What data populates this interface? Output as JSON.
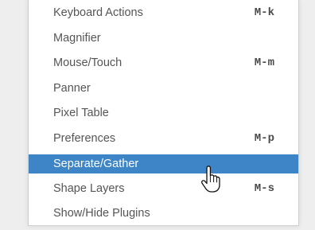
{
  "menu": {
    "items": [
      {
        "label": "Keyboard Actions",
        "shortcut": "M-k"
      },
      {
        "label": "Magnifier",
        "shortcut": ""
      },
      {
        "label": "Mouse/Touch",
        "shortcut": "M-m"
      },
      {
        "label": "Panner",
        "shortcut": ""
      },
      {
        "label": "Pixel Table",
        "shortcut": ""
      },
      {
        "label": "Preferences",
        "shortcut": "M-p"
      },
      {
        "label": "Separate/Gather",
        "shortcut": ""
      },
      {
        "label": "Shape Layers",
        "shortcut": "M-s"
      },
      {
        "label": "Show/Hide Plugins",
        "shortcut": ""
      }
    ],
    "selected_label": "Separate/Gather"
  },
  "colors": {
    "highlight": "#3d85c6",
    "text": "#555555",
    "menu_background": "#ffffff",
    "page_background": "#eeeeee"
  },
  "cursor": {
    "icon": "hand-pointer-icon"
  }
}
